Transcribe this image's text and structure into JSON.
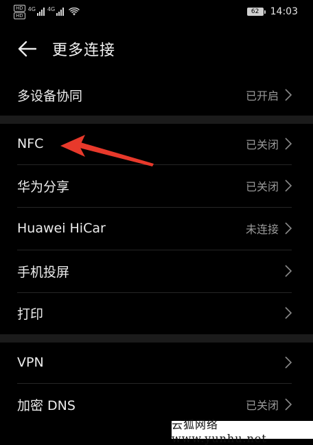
{
  "status_bar": {
    "hd_badges": [
      "HD",
      "HD"
    ],
    "net_tags": [
      "4G",
      "4G"
    ],
    "battery": "62",
    "time": "14:03"
  },
  "header": {
    "title": "更多连接",
    "back_icon": "arrow-left-icon"
  },
  "sections": [
    {
      "rows": [
        {
          "label": "多设备协同",
          "value": "已开启"
        }
      ]
    },
    {
      "rows": [
        {
          "label": "NFC",
          "value": "已关闭"
        },
        {
          "label": "华为分享",
          "value": "已关闭"
        },
        {
          "label": "Huawei HiCar",
          "value": "未连接"
        },
        {
          "label": "手机投屏",
          "value": ""
        },
        {
          "label": "打印",
          "value": ""
        }
      ]
    },
    {
      "rows": [
        {
          "label": "VPN",
          "value": ""
        },
        {
          "label": "加密 DNS",
          "value": "已关闭"
        }
      ]
    }
  ],
  "annotation": {
    "color": "#e8392b",
    "icon": "red-arrow-pointing-left"
  },
  "watermark": "云狐网络 www.yunhu.net",
  "colors": {
    "background": "#000000",
    "section_gap": "#1b1b1b",
    "label": "#ececec",
    "value": "#9a9a9a"
  }
}
